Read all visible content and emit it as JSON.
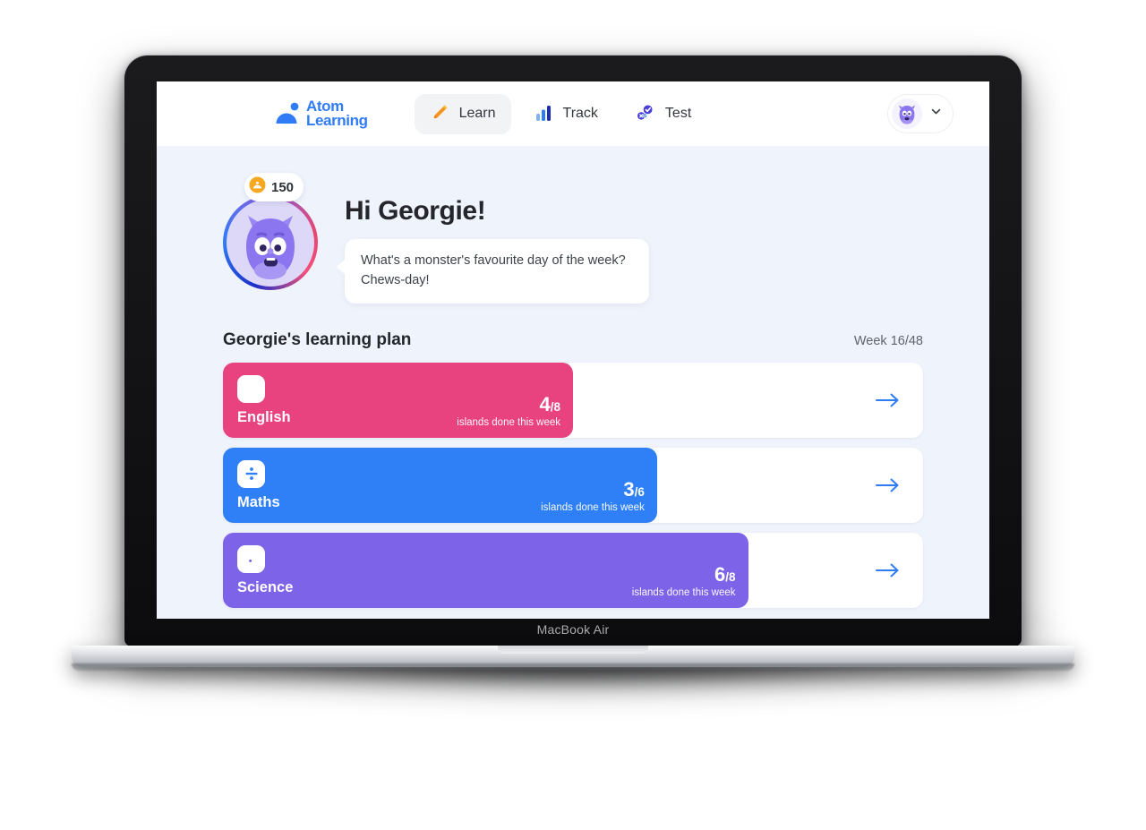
{
  "device": {
    "model_label": "MacBook Air"
  },
  "navbar": {
    "brand": {
      "line1": "Atom",
      "line2": "Learning",
      "icon": "atom-learning-logo-icon"
    },
    "tabs": [
      {
        "label": "Learn",
        "icon": "pencil-icon",
        "active": true
      },
      {
        "label": "Track",
        "icon": "bar-chart-icon",
        "active": false
      },
      {
        "label": "Test",
        "icon": "check-cross-badge-icon",
        "active": false
      }
    ],
    "profile": {
      "avatar_icon": "monster-avatar-icon",
      "chevron_icon": "chevron-down-icon"
    }
  },
  "hero": {
    "coins": {
      "icon": "coin-icon",
      "value": "150"
    },
    "avatar_icon": "monster-avatar-large-icon",
    "greeting": "Hi Georgie!",
    "joke_line_1": "What's a monster's favourite day of the week?",
    "joke_line_2": "Chews-day!"
  },
  "plan": {
    "title": "Georgie's learning plan",
    "week_label": "Week 16/48",
    "caption": "islands done this week",
    "arrow_icon": "arrow-right-icon",
    "subjects": [
      {
        "name": "English",
        "icon": "book-icon",
        "done": "4",
        "total": "/8",
        "caption": "islands done this week",
        "color": "#e8437f",
        "fill_percent": 50
      },
      {
        "name": "Maths",
        "icon": "division-icon",
        "done": "3",
        "total": "/6",
        "caption": "islands done this week",
        "color": "#2f80f7",
        "fill_percent": 62
      },
      {
        "name": "Science",
        "icon": "flask-icon",
        "done": "6",
        "total": "/8",
        "caption": "islands done this week",
        "color": "#7d63e8",
        "fill_percent": 75
      }
    ]
  },
  "colors": {
    "page_background": "#eff3fb",
    "surface": "#ffffff",
    "brand_blue": "#2f7cf6",
    "accent_pink": "#e8437f",
    "accent_purple": "#7d63e8",
    "text_primary": "#24262b",
    "text_muted": "#5e646e"
  }
}
